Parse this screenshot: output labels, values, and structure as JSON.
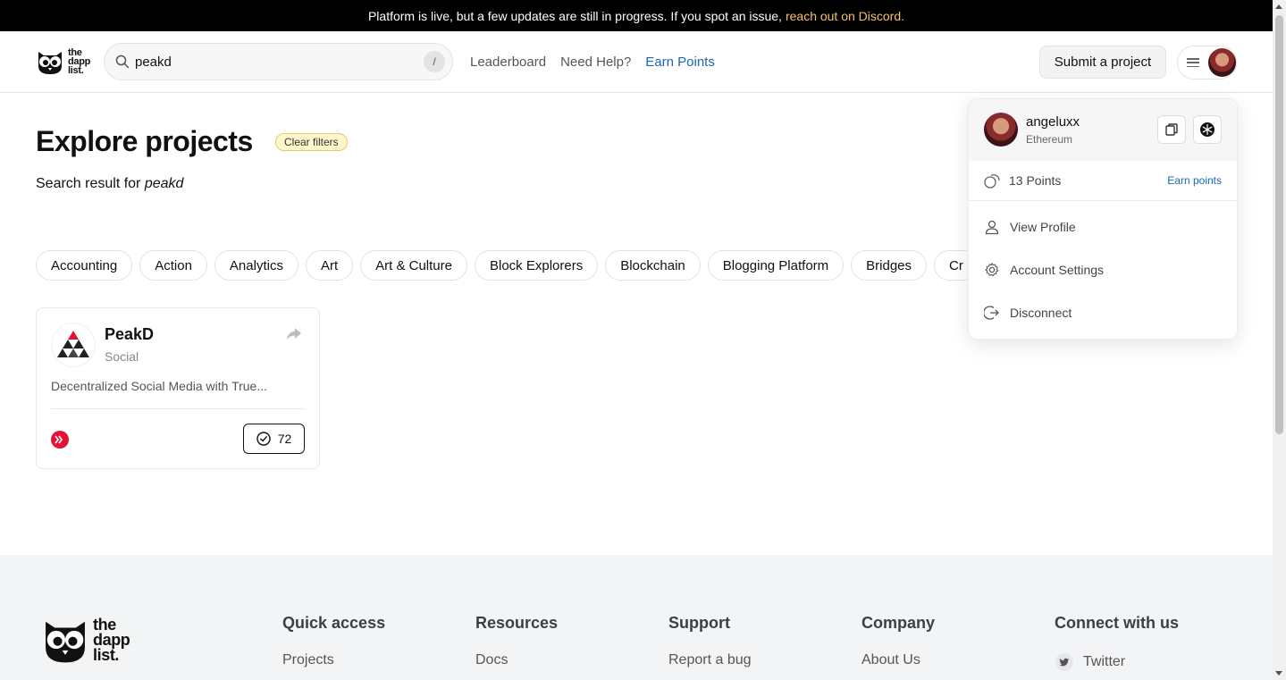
{
  "banner": {
    "text": "Platform is live, but a few updates are still in progress. If you spot an issue,",
    "link": "reach out on Discord."
  },
  "header": {
    "logo_text": [
      "the",
      "dapp",
      "list."
    ],
    "search": {
      "value": "peakd",
      "shortcut": "/"
    },
    "nav": [
      {
        "label": "Leaderboard"
      },
      {
        "label": "Need Help?"
      },
      {
        "label": "Earn Points",
        "accent": true
      }
    ],
    "submit_label": "Submit a project"
  },
  "page": {
    "title": "Explore projects",
    "clear_filters": "Clear filters",
    "search_prefix": "Search result for",
    "search_term": "peakd"
  },
  "categories": [
    "Accounting",
    "Action",
    "Analytics",
    "Art",
    "Art & Culture",
    "Block Explorers",
    "Blockchain",
    "Blogging Platform",
    "Bridges",
    "Cr"
  ],
  "project": {
    "name": "PeakD",
    "category": "Social",
    "description": "Decentralized Social Media with True...",
    "votes": "72",
    "chain_color": "#e31337"
  },
  "account_menu": {
    "username": "angeluxx",
    "network": "Ethereum",
    "points": "13 Points",
    "earn_points": "Earn points",
    "items": [
      {
        "label": "View Profile",
        "icon": "user-icon"
      },
      {
        "label": "Account Settings",
        "icon": "gear-icon"
      },
      {
        "label": "Disconnect",
        "icon": "logout-icon"
      }
    ]
  },
  "footer": {
    "columns": [
      {
        "title": "Quick access",
        "first_link": "Projects"
      },
      {
        "title": "Resources",
        "first_link": "Docs"
      },
      {
        "title": "Support",
        "first_link": "Report a bug"
      },
      {
        "title": "Company",
        "first_link": "About Us"
      },
      {
        "title": "Connect with us",
        "first_link": "Twitter"
      }
    ]
  },
  "colors": {
    "accent": "#1a67b8",
    "banner_link": "#f5c065",
    "badge_bg": "#fff6cc"
  }
}
